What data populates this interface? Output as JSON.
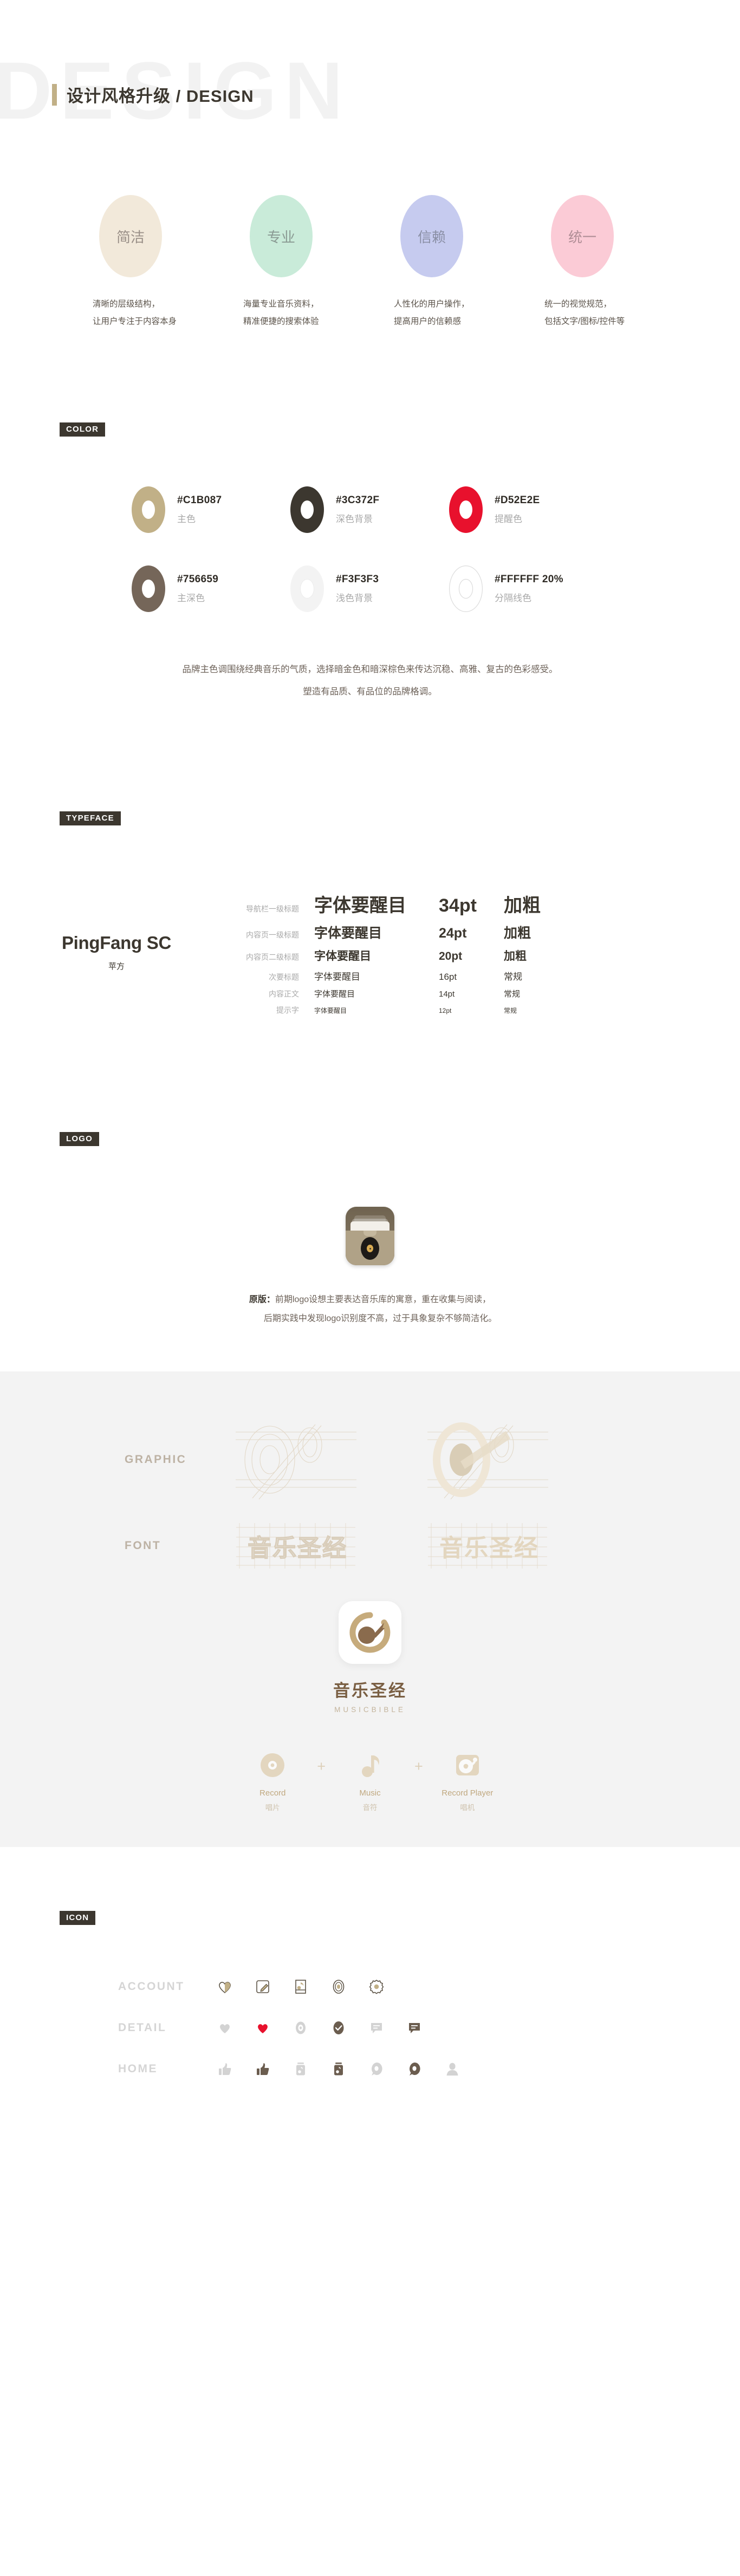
{
  "header": {
    "watermark": "DESIGN",
    "title": "设计风格升级 / DESIGN",
    "accent_color": "#C1B087"
  },
  "principles": [
    {
      "badge": "简洁",
      "badge_color": "#F2E9DA",
      "badge_text_color": "#9a9088",
      "desc_line1": "清晰的层级结构，",
      "desc_line2": "让用户专注于内容本身"
    },
    {
      "badge": "专业",
      "badge_color": "#C9EBD9",
      "badge_text_color": "#8a9a93",
      "desc_line1": "海量专业音乐资料，",
      "desc_line2": "精准便捷的搜索体验"
    },
    {
      "badge": "信赖",
      "badge_color": "#C6CBEF",
      "badge_text_color": "#8a8fa5",
      "desc_line1": "人性化的用户操作，",
      "desc_line2": "提高用户的信赖感"
    },
    {
      "badge": "统一",
      "badge_color": "#FBCBD6",
      "badge_text_color": "#b08e96",
      "desc_line1": "统一的视觉规范，",
      "desc_line2": "包括文字/图标/控件等"
    }
  ],
  "color": {
    "tag": "COLOR",
    "swatches": [
      {
        "hex": "#C1B087",
        "label": "主色",
        "fill": "#C1B087"
      },
      {
        "hex": "#3C372F",
        "label": "深色背景",
        "fill": "#3C372F"
      },
      {
        "hex": "#D52E2E",
        "label": "提醒色",
        "fill": "#E8112D"
      },
      {
        "hex": "#756659",
        "label": "主深色",
        "fill": "#756659"
      },
      {
        "hex": "#F3F3F3",
        "label": "浅色背景",
        "fill": "#F3F3F3"
      },
      {
        "hex": "#FFFFFF 20%",
        "label": "分隔线色",
        "fill": "#FFFFFF"
      }
    ],
    "note_line1": "品牌主色调围绕经典音乐的气质，选择暗金色和暗深棕色来传达沉稳、高雅、复古的色彩感受。",
    "note_line2": "塑造有品质、有品位的品牌格调。"
  },
  "typeface": {
    "tag": "TYPEFACE",
    "font_name": "PingFang SC",
    "font_name_cn": "苹方",
    "rows": [
      {
        "role": "导航栏一级标题",
        "sample": "字体要醒目",
        "size": "34pt",
        "weight": "加粗",
        "px": 34,
        "bold": true
      },
      {
        "role": "内容页一级标题",
        "sample": "字体要醒目",
        "size": "24pt",
        "weight": "加粗",
        "px": 25,
        "bold": true
      },
      {
        "role": "内容页二级标题",
        "sample": "字体要醒目",
        "size": "20pt",
        "weight": "加粗",
        "px": 21,
        "bold": true
      },
      {
        "role": "次要标题",
        "sample": "字体要醒目",
        "size": "16pt",
        "weight": "常规",
        "px": 17,
        "bold": false
      },
      {
        "role": "内容正文",
        "sample": "字体要醒目",
        "size": "14pt",
        "weight": "常规",
        "px": 15,
        "bold": false
      },
      {
        "role": "提示字",
        "sample": "字体要醒目",
        "size": "12pt",
        "weight": "常规",
        "px": 12,
        "bold": false
      }
    ]
  },
  "logo": {
    "tag": "LOGO",
    "note_prefix": "原版：",
    "note_line1": "前期logo设想主要表达音乐库的寓意，重在收集与阅读，",
    "note_line2": "后期实践中发现logo识别度不高，过于具象复杂不够简洁化。"
  },
  "brand": {
    "graphic_label": "GRAPHIC",
    "font_label": "FONT",
    "wordmark": "音乐圣经",
    "name_cn": "音乐圣经",
    "name_en": "MUSICBIBLE",
    "formula": [
      {
        "icon": "record-icon",
        "en": "Record",
        "cn": "唱片"
      },
      {
        "icon": "music-note-icon",
        "en": "Music",
        "cn": "音符"
      },
      {
        "icon": "record-player-icon",
        "en": "Record Player",
        "cn": "唱机"
      }
    ],
    "plus": "+"
  },
  "icons": {
    "tag": "ICON",
    "rows": [
      {
        "label": "ACCOUNT",
        "items": [
          "heart-outline-icon",
          "edit-note-icon",
          "music-card-icon",
          "record-outline-icon",
          "gear-icon"
        ]
      },
      {
        "label": "DETAIL",
        "items": [
          "heart-grey-icon",
          "heart-red-icon",
          "record-grey-icon",
          "check-circle-icon",
          "comment-grey-icon",
          "comment-dark-icon"
        ]
      },
      {
        "label": "HOME",
        "items": [
          "thumb-up-grey-icon",
          "thumb-up-dark-icon",
          "music-box-grey-icon",
          "music-box-dark-icon",
          "search-grey-icon",
          "search-dark-icon",
          "user-grey-icon"
        ]
      }
    ]
  }
}
